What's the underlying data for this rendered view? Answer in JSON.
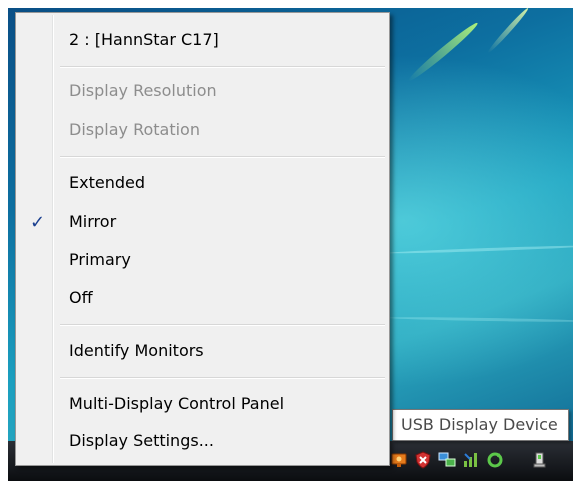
{
  "menu": {
    "display_header": "2 : [HannStar C17]",
    "display_resolution": "Display Resolution",
    "display_rotation": "Display Rotation",
    "extended": "Extended",
    "mirror": "Mirror",
    "mirror_checked": true,
    "primary": "Primary",
    "off": "Off",
    "identify_monitors": "Identify Monitors",
    "multi_display_control_panel": "Multi-Display Control Panel",
    "display_settings": "Display Settings..."
  },
  "tooltip": {
    "text": "USB Display Device"
  },
  "tray": {
    "icons": [
      "usb-display-icon",
      "security-shield-icon",
      "network-icon",
      "network-status-icon",
      "sync-icon",
      "safely-remove-hardware-icon"
    ]
  }
}
